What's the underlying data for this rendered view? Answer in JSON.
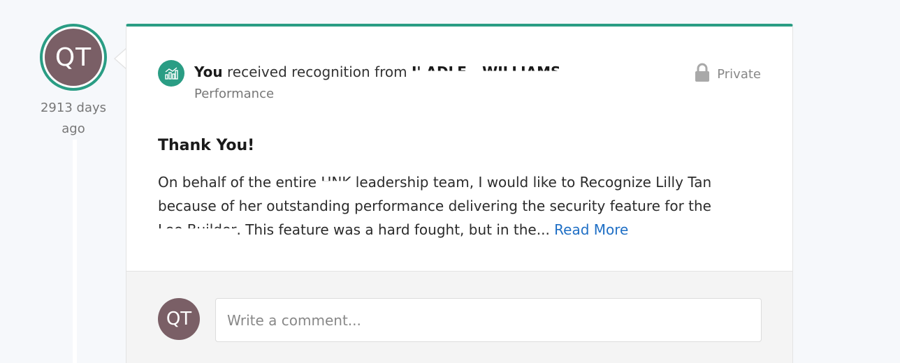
{
  "author": {
    "initials": "QT",
    "days_ago": "2913 days ago",
    "avatar_color": "#7a5f66"
  },
  "accent_color": "#2a9d84",
  "recognition": {
    "you": "You",
    "received_text": " received recognition from ",
    "sender_name": "I' ADLE - WILLIAMS",
    "category": "Performance",
    "category_icon": "chart-icon",
    "privacy_label": "Private",
    "privacy_icon": "lock-icon",
    "title": "Thank You!",
    "message_part1": "On behalf of the entire ",
    "message_masked1": "HNK",
    "message_part2": " leadership team, I would like to Recognize Lilly Tan because of her outstanding performance delivering the security feature for the ",
    "message_masked2": "Lee Builder",
    "message_part3": ". This feature was a hard fought, but in the...",
    "read_more": "Read More",
    "link_color": "#1f6fc5"
  },
  "comment": {
    "initials": "QT",
    "placeholder": "Write a comment..."
  }
}
